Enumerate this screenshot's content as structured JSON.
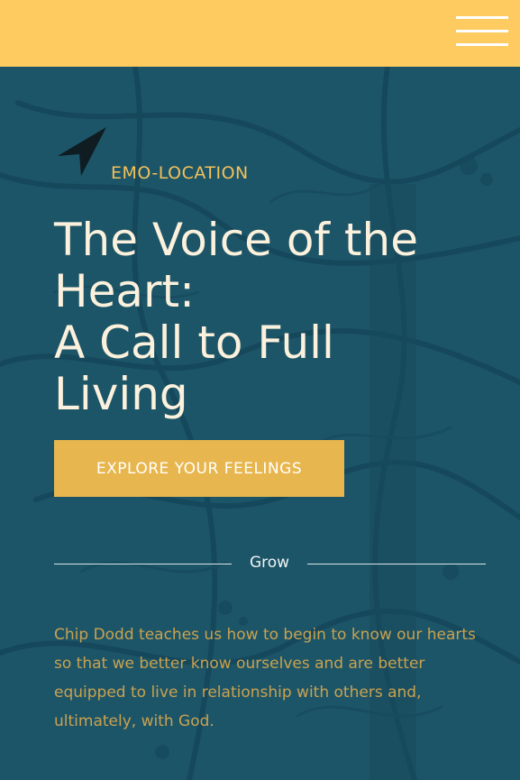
{
  "header": {
    "menu_icon": "hamburger-menu-icon",
    "background_color": "#fecb60"
  },
  "hero": {
    "background_color": "#1d5568",
    "tag_icon": "location-arrow-icon",
    "tag": "EMO-LOCATION",
    "title_lines": [
      "The Voice of the",
      "Heart:",
      "A Call to Full",
      "Living"
    ],
    "cta_label": "EXPLORE YOUR FEELINGS",
    "divider_label": "Grow",
    "description": "Chip Dodd teaches us how to begin to know our hearts so that we better know ourselves and are better equipped to live in relationship with others and, ultimately, with God.",
    "accent_color": "#e8b64e"
  }
}
